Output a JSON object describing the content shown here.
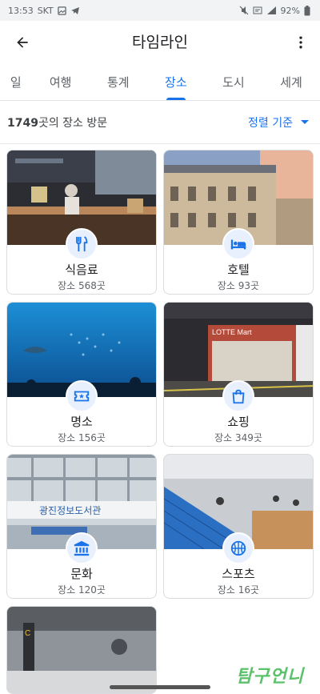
{
  "status_bar": {
    "time": "13:53",
    "carrier": "SKT",
    "battery": "92%"
  },
  "app_bar": {
    "title": "타임라인",
    "back_icon": "arrow-back-icon",
    "menu_icon": "more-vert-icon"
  },
  "tabs": [
    {
      "label": "일",
      "active": false
    },
    {
      "label": "여행",
      "active": false
    },
    {
      "label": "통계",
      "active": false
    },
    {
      "label": "장소",
      "active": true
    },
    {
      "label": "도시",
      "active": false
    },
    {
      "label": "세계",
      "active": false
    }
  ],
  "summary": {
    "count": "1749",
    "suffix": "곳의 장소 방문",
    "sort_label": "정렬 기준"
  },
  "categories": [
    {
      "name": "식음료",
      "count": "장소 568곳",
      "icon": "restaurant-icon"
    },
    {
      "name": "호텔",
      "count": "장소 93곳",
      "icon": "hotel-bed-icon"
    },
    {
      "name": "명소",
      "count": "장소 156곳",
      "icon": "attraction-ticket-icon"
    },
    {
      "name": "쇼핑",
      "count": "장소 349곳",
      "icon": "shopping-bag-icon"
    },
    {
      "name": "문화",
      "count": "장소 120곳",
      "icon": "museum-icon"
    },
    {
      "name": "스포츠",
      "count": "장소 16곳",
      "icon": "sports-ball-icon"
    }
  ],
  "photo_text": {
    "lotte": "LOTTE Mart",
    "library_sign": "광진정보도서관"
  },
  "watermark": "탐구언니",
  "colors": {
    "accent": "#1a73e8",
    "badge_bg": "#e8f0fe"
  }
}
